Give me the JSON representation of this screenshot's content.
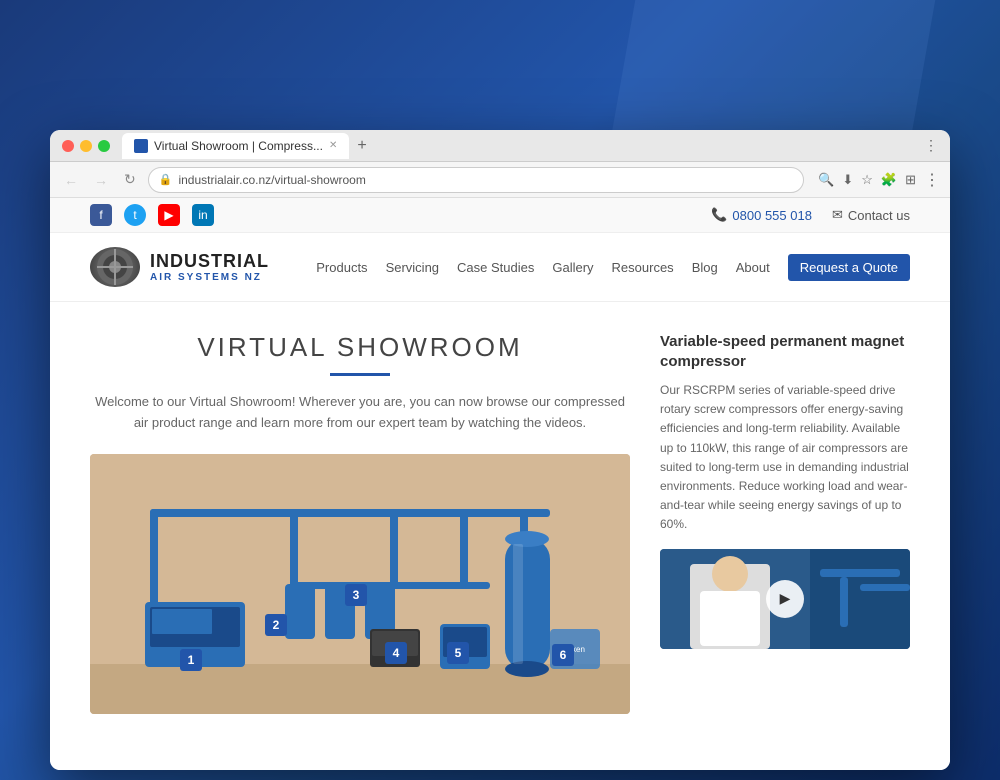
{
  "background": {
    "color": "#1a4a8a"
  },
  "browser": {
    "tab_label": "Virtual Showroom | Compress...",
    "url": "industrialair.co.nz/virtual-showroom",
    "new_tab_icon": "+",
    "back_disabled": true,
    "forward_disabled": true
  },
  "topbar": {
    "phone": "0800 555 018",
    "contact_label": "Contact us",
    "social": [
      "facebook",
      "twitter",
      "youtube",
      "linkedin"
    ]
  },
  "nav": {
    "logo_title": "INDUSTRIAL",
    "logo_sub": "AIR SYSTEMS NZ",
    "links": [
      "Products",
      "Servicing",
      "Case Studies",
      "Gallery",
      "Resources",
      "Blog",
      "About",
      "Request a Quote"
    ]
  },
  "page": {
    "title": "VIRTUAL SHOWROOM",
    "description": "Welcome to our Virtual Showroom! Wherever you are, you can now browse our compressed air product range and learn more from our expert team by watching the videos."
  },
  "product": {
    "title": "Variable-speed permanent magnet compressor",
    "description": "Our RSCRPM series of variable-speed drive rotary screw compressors offer energy-saving efficiencies and long-term reliability. Available up to 110kW, this range of air compressors are suited to long-term use in demanding industrial environments. Reduce working load and wear-and-tear while seeing energy savings of up to 60%.",
    "markers": [
      "1",
      "2",
      "3",
      "4",
      "5",
      "6"
    ]
  },
  "icons": {
    "phone": "📞",
    "email": "✉",
    "facebook": "f",
    "twitter": "t",
    "youtube": "▶",
    "linkedin": "in",
    "play": "▶",
    "lock": "🔒",
    "search": "🔍",
    "bookmark": "☆",
    "extension": "🧩",
    "tab_grid": "⊞",
    "dots_vertical": "⋮",
    "back": "←",
    "forward": "→",
    "refresh": "↻"
  }
}
